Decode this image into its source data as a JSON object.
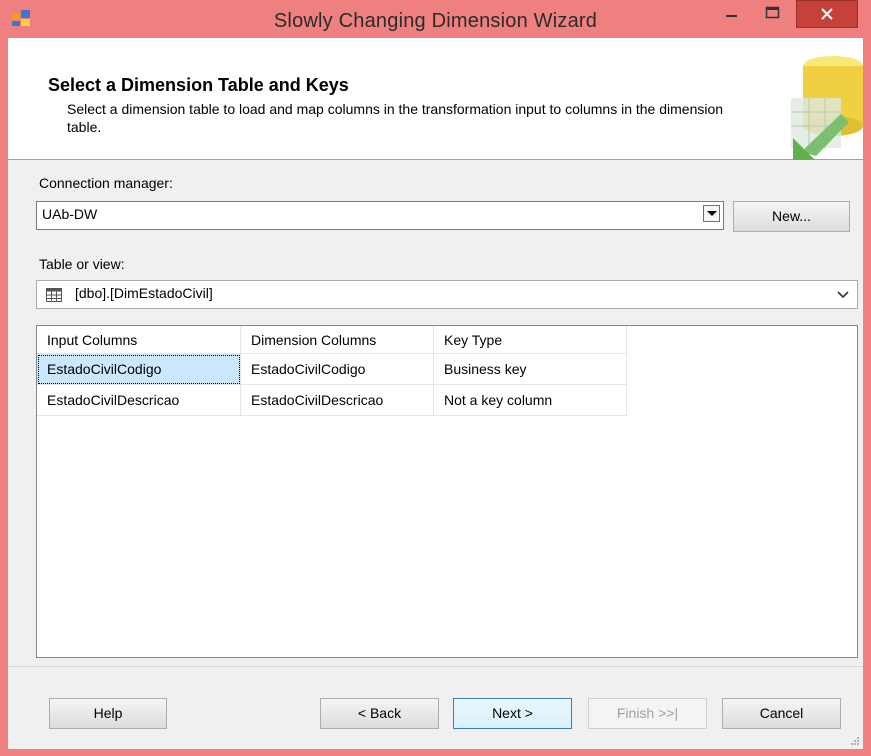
{
  "window": {
    "title": "Slowly Changing Dimension Wizard",
    "accent_color": "#f08080",
    "close_color": "#c7413b"
  },
  "header": {
    "title": "Select a Dimension Table and Keys",
    "description": "Select a dimension table to load and map columns in the transformation input to columns in the dimension table."
  },
  "connection": {
    "label": "Connection manager:",
    "value": "UAb-DW",
    "new_button": "New..."
  },
  "table_view": {
    "label": "Table or view:",
    "value": "[dbo].[DimEstadoCivil]",
    "icon": "table-icon"
  },
  "grid": {
    "columns": [
      "Input Columns",
      "Dimension Columns",
      "Key Type"
    ],
    "rows": [
      [
        "EstadoCivilCodigo",
        "EstadoCivilCodigo",
        "Business key"
      ],
      [
        "EstadoCivilDescricao",
        "EstadoCivilDescricao",
        "Not a key column"
      ]
    ],
    "selected_color": "#cce8ff"
  },
  "footer": {
    "help": "Help",
    "back": "< Back",
    "next": "Next >",
    "finish": "Finish >>|",
    "cancel": "Cancel"
  }
}
